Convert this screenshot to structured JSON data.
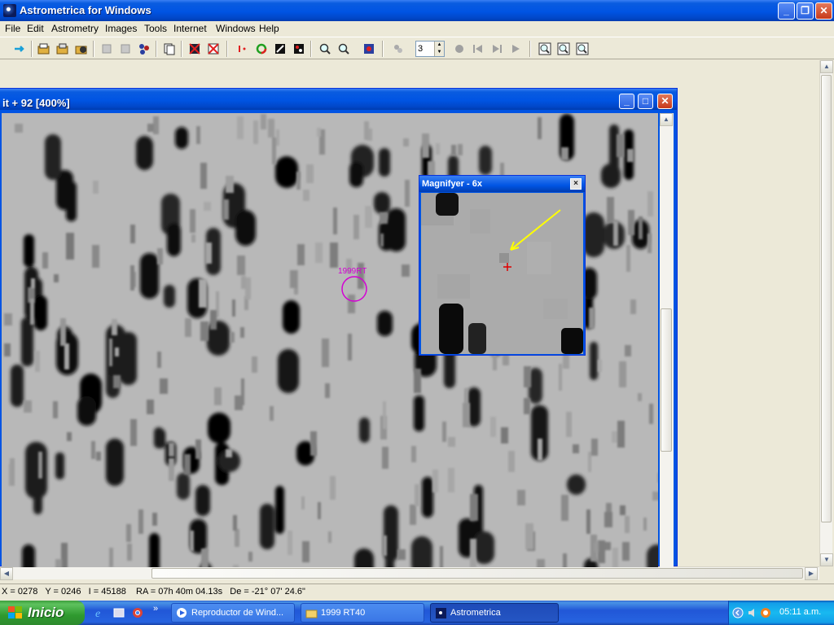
{
  "window": {
    "title": "Astrometrica for Windows"
  },
  "menu": [
    "File",
    "Edit",
    "Astrometry",
    "Images",
    "Tools",
    "Internet",
    "Windows",
    "Help"
  ],
  "toolbar": {
    "frame_spin_value": "3"
  },
  "image_window": {
    "title": "it + 92 [400%]",
    "object_label": "1999RT"
  },
  "magnifier": {
    "title": "Magnifyer - 6x",
    "close_glyph": "×"
  },
  "status": {
    "text": "X = 0278   Y = 0246   I = 45188    RA = 07h 40m 04.13s   De = -21° 07' 24.6\""
  },
  "taskbar": {
    "start_label": "Inicio",
    "tasks": [
      {
        "label": "Reproductor de Wind..."
      },
      {
        "label": "1999 RT40"
      },
      {
        "label": "Astrometrica"
      }
    ],
    "clock": "05:11 a.m."
  },
  "colors": {
    "xp_blue": "#0054e3",
    "marker_magenta": "#d400d4",
    "arrow_yellow": "#ffff00",
    "cross_red": "#e00000"
  }
}
